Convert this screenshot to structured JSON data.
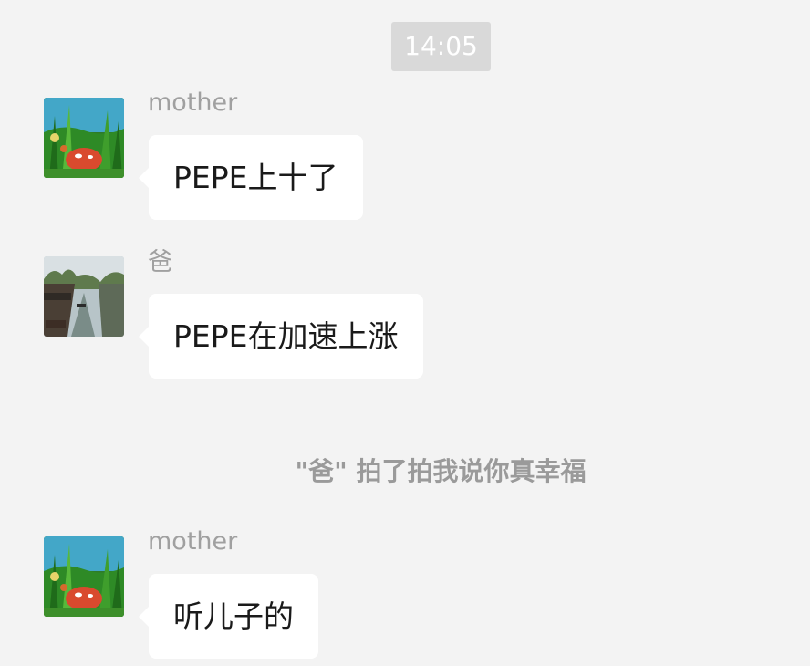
{
  "chat": {
    "timestamp": "14:05",
    "messages": [
      {
        "sender": "mother",
        "text": "PEPE上十了",
        "avatar_icon": "garden-mushroom-avatar"
      },
      {
        "sender": "爸",
        "text": "PEPE在加速上涨",
        "avatar_icon": "river-town-avatar"
      },
      {
        "sender": "mother",
        "text": "听儿子的",
        "avatar_icon": "garden-mushroom-avatar"
      }
    ],
    "system_note": "\"爸\" 拍了拍我说你真幸福"
  },
  "colors": {
    "background": "#f3f3f3",
    "bubble": "#ffffff",
    "timestamp_pill": "#d9d9d9",
    "sender_text": "#a0a0a0",
    "system_text": "#9a9a9a"
  }
}
